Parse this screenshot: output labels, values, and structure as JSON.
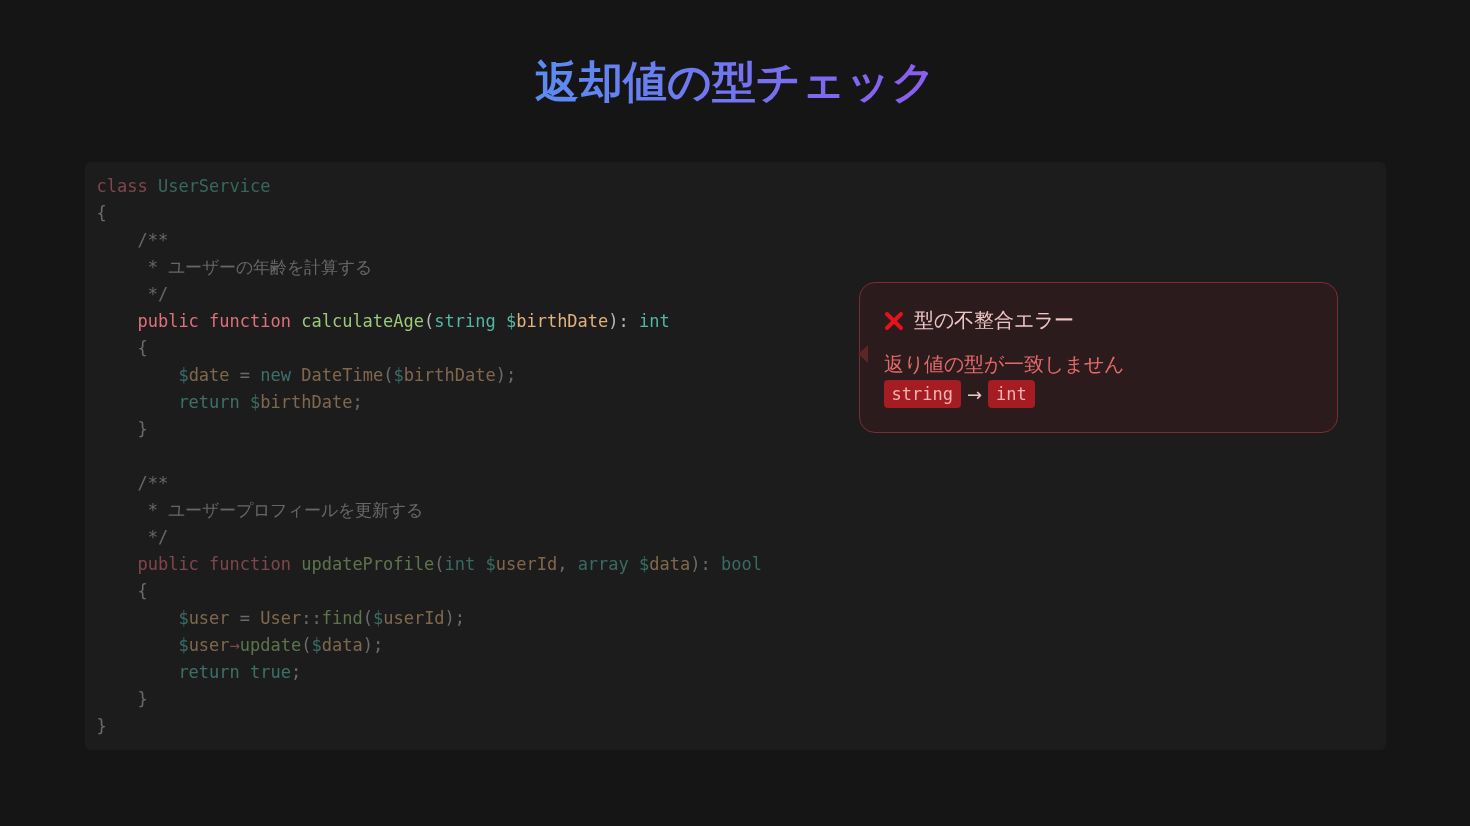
{
  "title": "返却値の型チェック",
  "code": {
    "groups": [
      [
        {
          "focused": false,
          "tokens": [
            {
              "kind": "keyword",
              "text": "class"
            },
            {
              "kind": "class",
              "text": " UserService"
            }
          ]
        },
        {
          "focused": false,
          "tokens": [
            {
              "kind": "punct",
              "text": "{"
            }
          ]
        },
        {
          "focused": false,
          "tokens": [
            {
              "kind": "comment",
              "text": "    /**"
            }
          ]
        },
        {
          "focused": false,
          "tokens": [
            {
              "kind": "comment",
              "text": "     * ユーザーの年齢を計算する"
            }
          ]
        },
        {
          "focused": false,
          "tokens": [
            {
              "kind": "comment",
              "text": "     */"
            }
          ]
        },
        {
          "focused": true,
          "tokens": [
            {
              "kind": "keyword",
              "text": "    public function"
            },
            {
              "kind": "function",
              "text": " calculateAge"
            },
            {
              "kind": "punct",
              "text": "("
            },
            {
              "kind": "type",
              "text": "string"
            },
            {
              "kind": "sigil",
              "text": " $"
            },
            {
              "kind": "var",
              "text": "birthDate"
            },
            {
              "kind": "punct",
              "text": "): "
            },
            {
              "kind": "type",
              "text": "int"
            }
          ]
        },
        {
          "focused": false,
          "tokens": [
            {
              "kind": "punct",
              "text": "    {"
            }
          ]
        },
        {
          "focused": false,
          "tokens": [
            {
              "kind": "sigil",
              "text": "        $"
            },
            {
              "kind": "var",
              "text": "date"
            },
            {
              "kind": "punct",
              "text": " = "
            },
            {
              "kind": "control",
              "text": "new"
            },
            {
              "kind": "var",
              "text": " DateTime"
            },
            {
              "kind": "punct",
              "text": "("
            },
            {
              "kind": "sigil",
              "text": "$"
            },
            {
              "kind": "var",
              "text": "birthDate"
            },
            {
              "kind": "punct",
              "text": ");"
            }
          ]
        },
        {
          "focused": false,
          "tokens": [
            {
              "kind": "control",
              "text": "        return"
            },
            {
              "kind": "sigil",
              "text": " $"
            },
            {
              "kind": "var",
              "text": "birthDate"
            },
            {
              "kind": "punct",
              "text": ";"
            }
          ]
        },
        {
          "focused": false,
          "tokens": [
            {
              "kind": "punct",
              "text": "    }"
            }
          ]
        }
      ],
      [
        {
          "focused": false,
          "tokens": [
            {
              "kind": "comment",
              "text": "    /**"
            }
          ]
        },
        {
          "focused": false,
          "tokens": [
            {
              "kind": "comment",
              "text": "     * ユーザープロフィールを更新する"
            }
          ]
        },
        {
          "focused": false,
          "tokens": [
            {
              "kind": "comment",
              "text": "     */"
            }
          ]
        },
        {
          "focused": false,
          "tokens": [
            {
              "kind": "keyword",
              "text": "    public function"
            },
            {
              "kind": "function",
              "text": " updateProfile"
            },
            {
              "kind": "punct",
              "text": "("
            },
            {
              "kind": "type",
              "text": "int"
            },
            {
              "kind": "sigil",
              "text": " $"
            },
            {
              "kind": "var",
              "text": "userId"
            },
            {
              "kind": "punct",
              "text": ", "
            },
            {
              "kind": "type",
              "text": "array"
            },
            {
              "kind": "sigil",
              "text": " $"
            },
            {
              "kind": "var",
              "text": "data"
            },
            {
              "kind": "punct",
              "text": "): "
            },
            {
              "kind": "type",
              "text": "bool"
            }
          ]
        },
        {
          "focused": false,
          "tokens": [
            {
              "kind": "punct",
              "text": "    {"
            }
          ]
        },
        {
          "focused": false,
          "tokens": [
            {
              "kind": "sigil",
              "text": "        $"
            },
            {
              "kind": "var",
              "text": "user"
            },
            {
              "kind": "punct",
              "text": " = "
            },
            {
              "kind": "var",
              "text": "User"
            },
            {
              "kind": "punct",
              "text": "::"
            },
            {
              "kind": "function",
              "text": "find"
            },
            {
              "kind": "punct",
              "text": "("
            },
            {
              "kind": "sigil",
              "text": "$"
            },
            {
              "kind": "var",
              "text": "userId"
            },
            {
              "kind": "punct",
              "text": ");"
            }
          ]
        },
        {
          "focused": false,
          "tokens": [
            {
              "kind": "sigil",
              "text": "        $"
            },
            {
              "kind": "var",
              "text": "user"
            },
            {
              "kind": "keyword",
              "text": "→"
            },
            {
              "kind": "function",
              "text": "update"
            },
            {
              "kind": "punct",
              "text": "("
            },
            {
              "kind": "sigil",
              "text": "$"
            },
            {
              "kind": "var",
              "text": "data"
            },
            {
              "kind": "punct",
              "text": ");"
            }
          ]
        },
        {
          "focused": false,
          "tokens": [
            {
              "kind": "control",
              "text": "        return true"
            },
            {
              "kind": "punct",
              "text": ";"
            }
          ]
        },
        {
          "focused": false,
          "tokens": [
            {
              "kind": "punct",
              "text": "    }"
            }
          ]
        },
        {
          "focused": false,
          "tokens": [
            {
              "kind": "punct",
              "text": "}"
            }
          ]
        }
      ]
    ]
  },
  "error": {
    "title": "型の不整合エラー",
    "message": "返り値の型が一致しません",
    "from": "string",
    "arrow": "→",
    "to": "int"
  }
}
